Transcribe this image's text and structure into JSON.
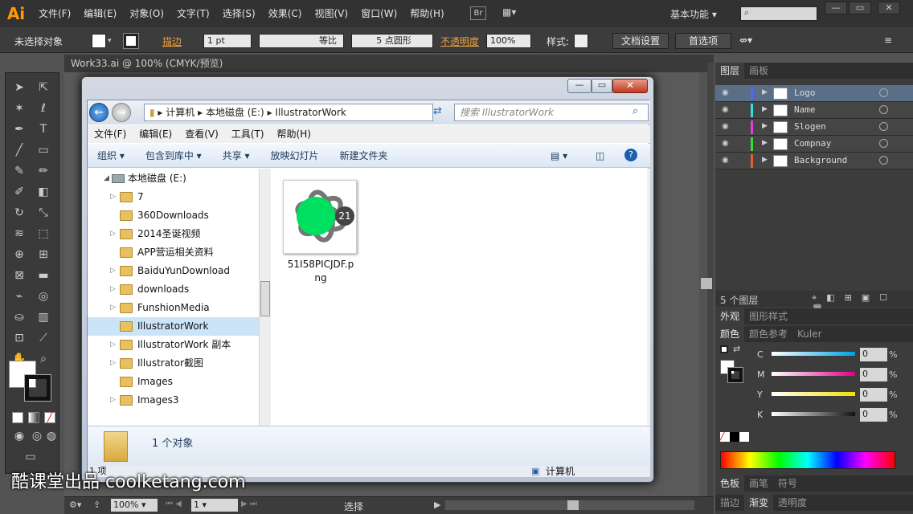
{
  "app": {
    "logo": "Ai",
    "bridge": "Br",
    "workspace": "基本功能"
  },
  "menu": [
    "文件(F)",
    "编辑(E)",
    "对象(O)",
    "文字(T)",
    "选择(S)",
    "效果(C)",
    "视图(V)",
    "窗口(W)",
    "帮助(H)"
  ],
  "control": {
    "selection": "未选择对象",
    "stroke_label": "描边",
    "stroke_value": "1 pt",
    "profile": "等比",
    "brush": "5 点圆形",
    "opacity_label": "不透明度",
    "opacity_value": "100%",
    "style_label": "样式:",
    "doc_setup": "文档设置",
    "prefs": "首选项"
  },
  "doc_tab": "Work33.ai @ 100% (CMYK/预览)",
  "explorer": {
    "path": [
      "计算机",
      "本地磁盘 (E:)",
      "IllustratorWork"
    ],
    "search_placeholder": "搜索 IllustratorWork",
    "menu": [
      "文件(F)",
      "编辑(E)",
      "查看(V)",
      "工具(T)",
      "帮助(H)"
    ],
    "toolbar": [
      "组织 ▾",
      "包含到库中 ▾",
      "共享 ▾",
      "放映幻灯片",
      "新建文件夹"
    ],
    "tree_root": "本地磁盘 (E:)",
    "tree": [
      {
        "label": "7",
        "selected": false
      },
      {
        "label": "360Downloads",
        "selected": false
      },
      {
        "label": "2014圣诞视频",
        "selected": false
      },
      {
        "label": "APP营运相关资料",
        "selected": false
      },
      {
        "label": "BaiduYunDownload",
        "selected": false
      },
      {
        "label": "downloads",
        "selected": false
      },
      {
        "label": "FunshionMedia",
        "selected": false
      },
      {
        "label": "IllustratorWork",
        "selected": true
      },
      {
        "label": "IllustratorWork 副本",
        "selected": false
      },
      {
        "label": "Illustrator截图",
        "selected": false
      },
      {
        "label": "Images",
        "selected": false
      },
      {
        "label": "Images3",
        "selected": false
      }
    ],
    "file_name": "51I58PICJDF.png",
    "badge": "21",
    "detail_count": "1 个对象",
    "status_left": "1 项",
    "status_right": "计算机"
  },
  "layers_panel": {
    "tabs": [
      "图层",
      "画板"
    ],
    "layers": [
      {
        "name": "Logo",
        "color": "#4a6cf0",
        "selected": true
      },
      {
        "name": "Name",
        "color": "#2ee0e0",
        "selected": false
      },
      {
        "name": "Slogen",
        "color": "#e040e0",
        "selected": false
      },
      {
        "name": "Compnay",
        "color": "#30e030",
        "selected": false
      },
      {
        "name": "Background",
        "color": "#e06030",
        "selected": false
      }
    ],
    "count": "5 个图层"
  },
  "appearance_tabs": [
    "外观",
    "图形样式"
  ],
  "color_panel": {
    "tabs": [
      "颜色",
      "颜色参考",
      "Kuler"
    ],
    "channels": [
      {
        "label": "C",
        "value": "0",
        "color": "#00a0e0"
      },
      {
        "label": "M",
        "value": "0",
        "color": "#e0008a"
      },
      {
        "label": "Y",
        "value": "0",
        "color": "#f0e000"
      },
      {
        "label": "K",
        "value": "0",
        "color": "#111111"
      }
    ],
    "unit": "%"
  },
  "bottom_tabs1": [
    "色板",
    "画笔",
    "符号"
  ],
  "bottom_tabs2": [
    "描边",
    "渐变",
    "透明度"
  ],
  "statusbar": {
    "zoom": "100%",
    "page": "1",
    "tool": "选择"
  },
  "watermark": "酷课堂出品 coolketang.com"
}
